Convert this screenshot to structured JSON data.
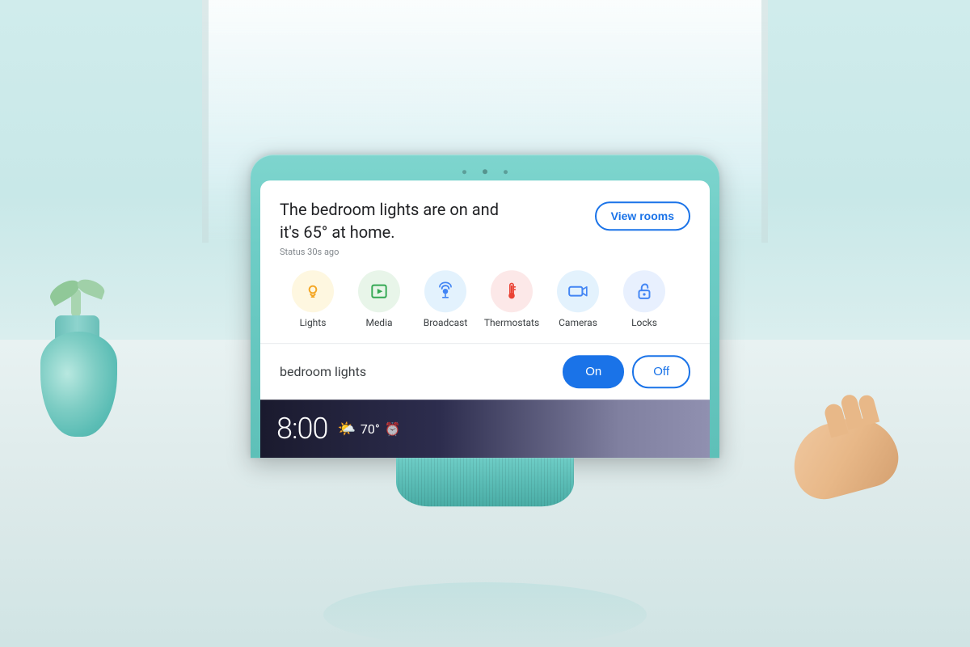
{
  "background": {
    "color": "#d0ecec"
  },
  "device": {
    "camera_dots": [
      "left",
      "center",
      "right"
    ]
  },
  "screen": {
    "main_text_line1": "The bedroom lights are on and",
    "main_text_line2": "it's 65° at home.",
    "status_text": "Status 30s ago",
    "view_rooms_label": "View rooms"
  },
  "icons": [
    {
      "id": "lights",
      "label": "Lights",
      "style": "lights"
    },
    {
      "id": "media",
      "label": "Media",
      "style": "media"
    },
    {
      "id": "broadcast",
      "label": "Broadcast",
      "style": "broadcast"
    },
    {
      "id": "thermostats",
      "label": "Thermostats",
      "style": "thermostats"
    },
    {
      "id": "cameras",
      "label": "Cameras",
      "style": "cameras"
    },
    {
      "id": "locks",
      "label": "Locks",
      "style": "locks"
    }
  ],
  "controls": {
    "device_label": "bedroom lights",
    "on_label": "On",
    "off_label": "Off"
  },
  "bottom_bar": {
    "time": "8:00",
    "temperature": "70°",
    "has_alarm": true
  }
}
